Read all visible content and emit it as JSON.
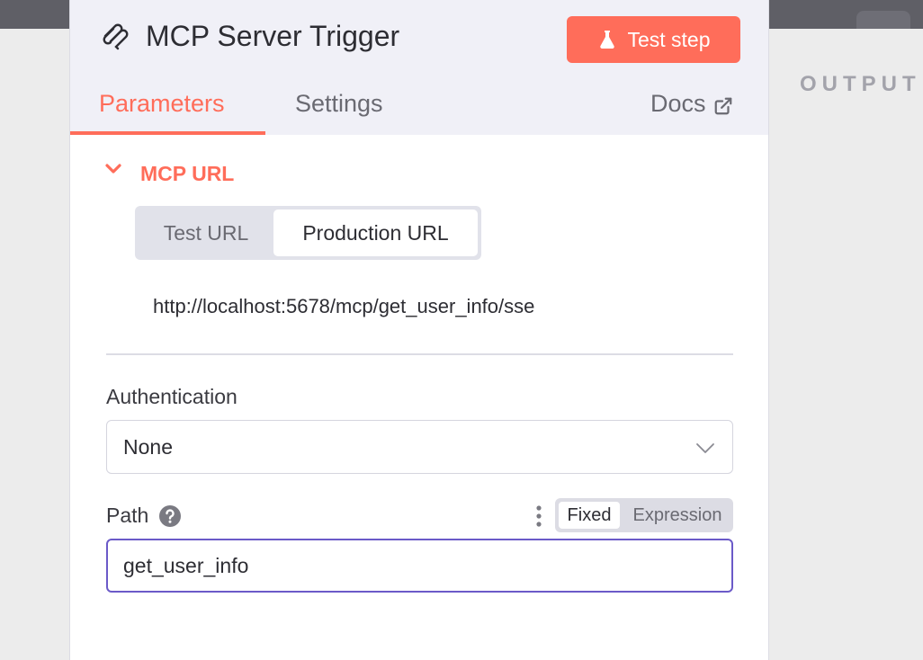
{
  "node": {
    "title": "MCP Server Trigger",
    "icon": "mcp-icon"
  },
  "header": {
    "test_button_label": "Test step",
    "test_button_icon": "flask-icon",
    "tabs": [
      {
        "label": "Parameters",
        "active": true
      },
      {
        "label": "Settings",
        "active": false
      }
    ],
    "docs_label": "Docs",
    "docs_icon": "external-link-icon"
  },
  "output_panel": {
    "label": "OUTPUT"
  },
  "section": {
    "title": "MCP URL",
    "expanded": true,
    "url_switch": {
      "options": [
        "Test URL",
        "Production URL"
      ],
      "selected": "Production URL"
    },
    "url": "http://localhost:5678/mcp/get_user_info/sse"
  },
  "authentication": {
    "label": "Authentication",
    "value": "None"
  },
  "path": {
    "label": "Path",
    "mode_options": [
      "Fixed",
      "Expression"
    ],
    "mode_selected": "Fixed",
    "value": "get_user_info"
  },
  "colors": {
    "accent": "#ff6d5a",
    "focus_border": "#6b5ac8"
  }
}
